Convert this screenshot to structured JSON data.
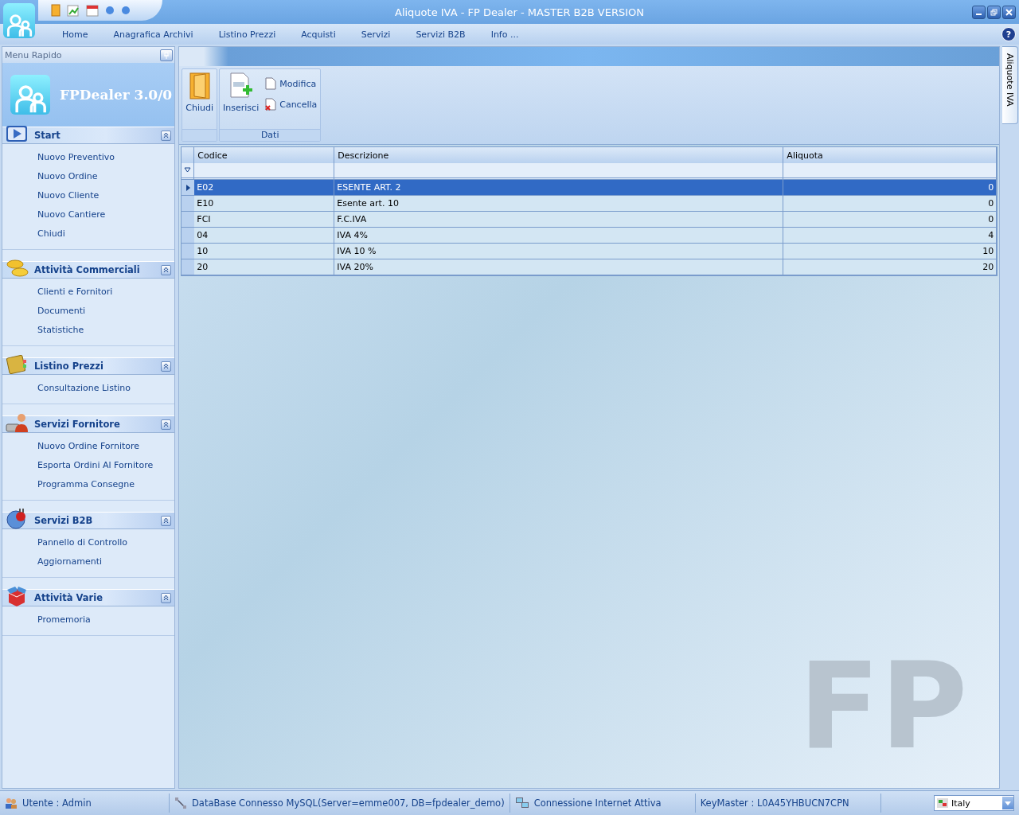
{
  "window": {
    "title": "Aliquote IVA - FP Dealer - MASTER B2B VERSION"
  },
  "menu": [
    {
      "label": "Home"
    },
    {
      "label": "Anagrafica Archivi"
    },
    {
      "label": "Listino Prezzi"
    },
    {
      "label": "Acquisti"
    },
    {
      "label": "Servizi"
    },
    {
      "label": "Servizi B2B"
    },
    {
      "label": "Info ..."
    }
  ],
  "sidebar": {
    "title": "Menu Rapido",
    "app_name": "FPDealer 3.0/0",
    "groups": [
      {
        "title": "Start",
        "expanded": true,
        "items": [
          "Nuovo Preventivo",
          "Nuovo Ordine",
          "Nuovo Cliente",
          "Nuovo Cantiere",
          "Chiudi"
        ]
      },
      {
        "title": "Attività Commerciali",
        "expanded": true,
        "items": [
          "Clienti e Fornitori",
          "Documenti",
          "Statistiche"
        ]
      },
      {
        "title": "Listino Prezzi",
        "expanded": true,
        "items": [
          "Consultazione Listino"
        ]
      },
      {
        "title": "Servizi Fornitore",
        "expanded": true,
        "items": [
          "Nuovo Ordine Fornitore",
          "Esporta Ordini Al Fornitore",
          "Programma Consegne"
        ]
      },
      {
        "title": "Servizi B2B",
        "expanded": true,
        "items": [
          "Pannello di Controllo",
          "Aggiornamenti"
        ]
      },
      {
        "title": "Attività Varie",
        "expanded": true,
        "items": [
          "Promemoria"
        ]
      }
    ]
  },
  "ribbon": {
    "groups": [
      {
        "buttons": [
          {
            "label": "Chiudi",
            "kind": "large"
          }
        ]
      },
      {
        "label": "Dati",
        "buttons": [
          {
            "label": "Inserisci",
            "kind": "large"
          },
          {
            "label": "Modifica",
            "kind": "small"
          },
          {
            "label": "Cancella",
            "kind": "small"
          }
        ]
      }
    ]
  },
  "help": "?",
  "table": {
    "columns": [
      "Codice",
      "Descrizione",
      "Aliquota"
    ],
    "rows": [
      {
        "cells": [
          "E02",
          "ESENTE ART. 2",
          "0"
        ],
        "selected": true
      },
      {
        "cells": [
          "E10",
          "Esente art. 10",
          "0"
        ],
        "selected": false
      },
      {
        "cells": [
          "FCI",
          "F.C.IVA",
          "0"
        ],
        "selected": false
      },
      {
        "cells": [
          "04",
          "IVA 4%",
          "4"
        ],
        "selected": false
      },
      {
        "cells": [
          "10",
          "IVA 10 %",
          "10"
        ],
        "selected": false
      },
      {
        "cells": [
          "20",
          "IVA 20%",
          "20"
        ],
        "selected": false
      }
    ]
  },
  "logo": "FP",
  "side_tab": {
    "label": "Aliquote IVA"
  },
  "status_bar": [
    {
      "text": "Utente : Admin"
    },
    {
      "text": "DataBase Connesso MySQL(Server=emme007, DB=fpdealer_demo)"
    },
    {
      "text": "Connessione Internet Attiva"
    },
    {
      "text": "KeyMaster : L0A45YHBUCN7CPN"
    }
  ],
  "locale": "Italy"
}
